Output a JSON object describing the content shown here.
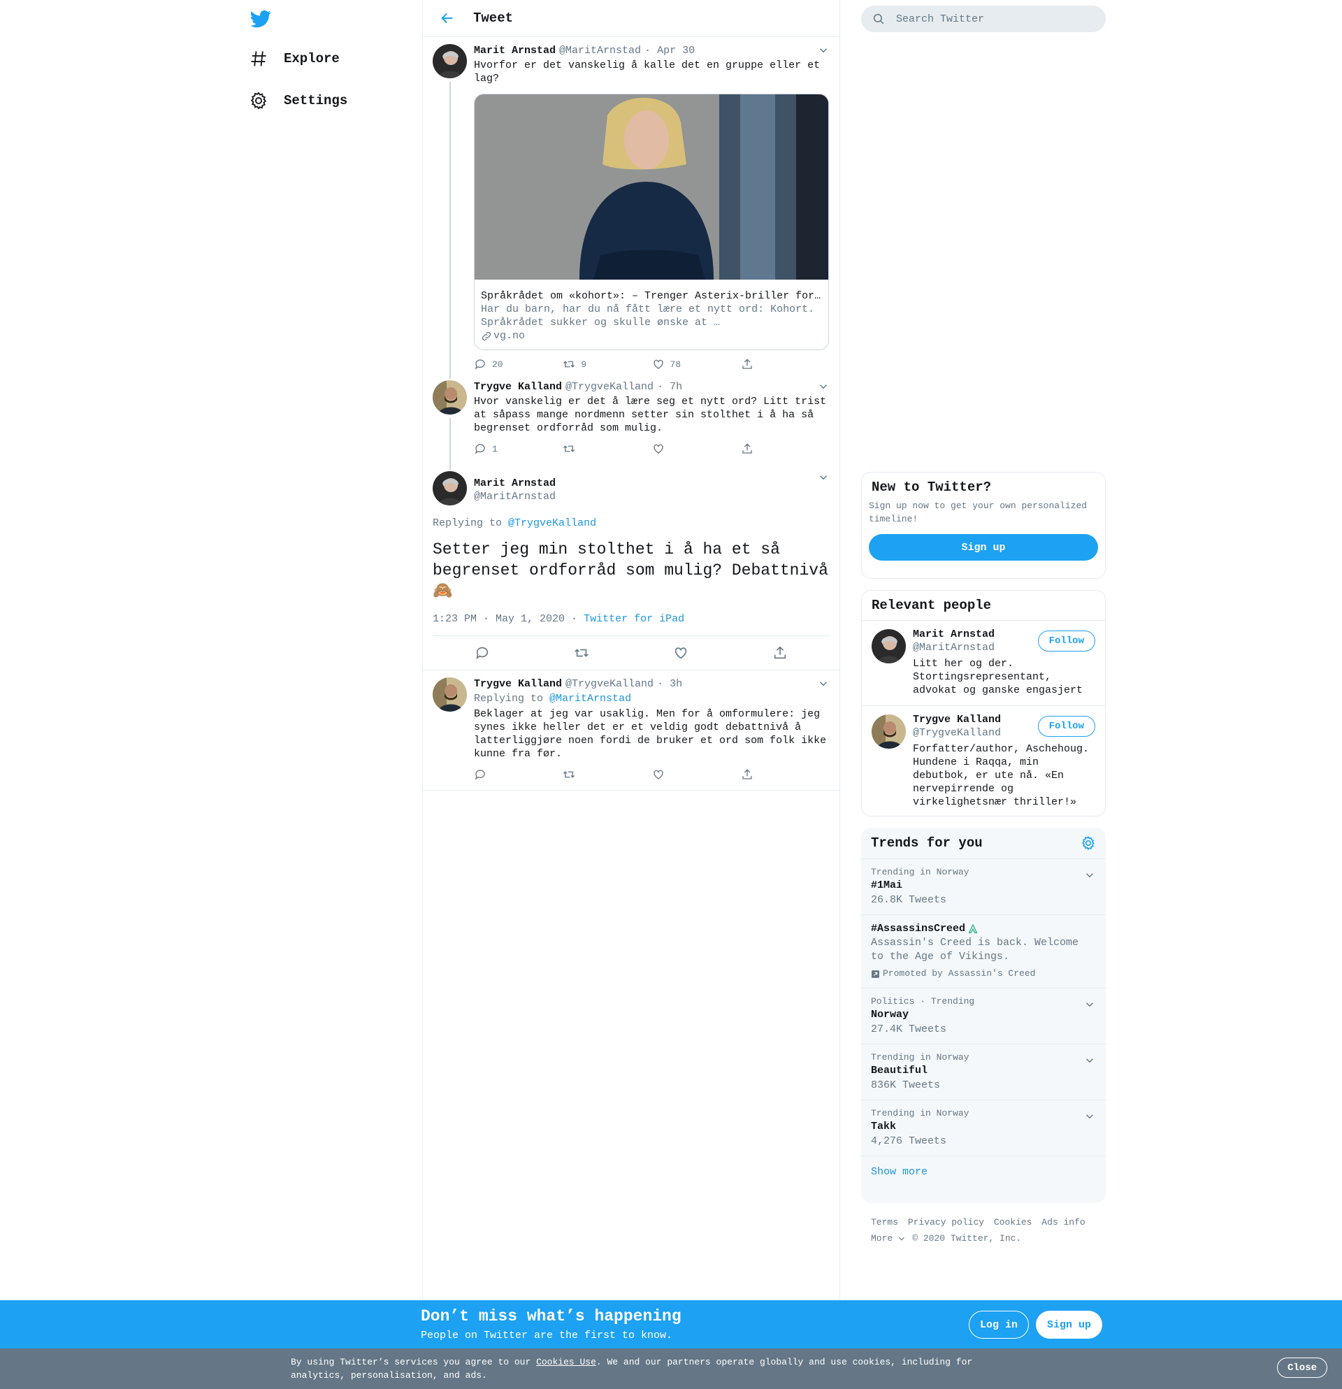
{
  "colors": {
    "accent": "#1da1f2",
    "link": "#1b95e0",
    "muted": "#657786",
    "border": "#e6ecf0"
  },
  "nav": {
    "items": [
      {
        "label": "Explore",
        "icon": "hashtag-icon"
      },
      {
        "label": "Settings",
        "icon": "gear-icon"
      }
    ]
  },
  "header": {
    "title": "Tweet"
  },
  "thread": [
    {
      "name": "Marit Arnstad",
      "handle": "@MaritArnstad",
      "time": "· Apr 30",
      "text": "Hvorfor er det vanskelig å kalle det en gruppe eller et lag?",
      "card": {
        "title": "Språkrådet om «kohort»: – Trenger Asterix-briller for…",
        "description": "Har du barn, har du nå fått lære et nytt ord: Kohort. Språkrådet sukker og skulle ønske at …",
        "domain": "vg.no"
      },
      "counts": {
        "reply": "20",
        "retweet": "9",
        "like": "78"
      }
    },
    {
      "name": "Trygve Kalland",
      "handle": "@TrygveKalland",
      "time": "· 7h",
      "text": "Hvor vanskelig er det å lære seg et nytt ord? Litt trist at såpass mange nordmenn setter sin stolthet i å ha så begrenset ordforråd som mulig.",
      "counts": {
        "reply": "1",
        "retweet": "",
        "like": ""
      }
    }
  ],
  "main_tweet": {
    "name": "Marit Arnstad",
    "handle": "@MaritArnstad",
    "replying_prefix": "Replying to",
    "replying_to": "@TrygveKalland",
    "text": "Setter jeg min stolthet i å ha et så begrenset ordforråd som mulig? Debattnivå",
    "emoji": "🙈",
    "timestamp": "1:23 PM · May 1, 2020 ·",
    "source": "Twitter for iPad"
  },
  "reply": {
    "name": "Trygve Kalland",
    "handle": "@TrygveKalland",
    "time": "· 3h",
    "replying_prefix": "Replying to",
    "replying_to": "@MaritArnstad",
    "text": "Beklager at jeg var usaklig. Men for å omformulere: jeg synes ikke heller det er et veldig godt debattnivå å latterliggjøre noen fordi de bruker et ord som folk ikke kunne fra før."
  },
  "search": {
    "placeholder": "Search Twitter"
  },
  "new_to_twitter": {
    "title": "New to Twitter?",
    "description": "Sign up now to get your own personalized timeline!",
    "button": "Sign up"
  },
  "relevant_people": {
    "title": "Relevant people",
    "people": [
      {
        "name": "Marit Arnstad",
        "handle": "@MaritArnstad",
        "bio": "Litt her og der. Stortingsrepresentant, advokat og ganske engasjert",
        "button": "Follow"
      },
      {
        "name": "Trygve Kalland",
        "handle": "@TrygveKalland",
        "bio": "Forfatter/author, Aschehoug. Hundene i Raqqa, min debutbok, er ute nå. «En nervepirrende og virkelighetsnær thriller!»",
        "button": "Follow"
      }
    ]
  },
  "trends": {
    "title": "Trends for you",
    "items": [
      {
        "meta": "Trending in Norway",
        "name": "#1Mai",
        "count": "26.8K Tweets"
      },
      {
        "name": "#AssassinsCreed",
        "description": "Assassin's Creed is back. Welcome to the Age of Vikings.",
        "promoted": "Promoted by Assassin's Creed"
      },
      {
        "meta": "Politics · Trending",
        "name": "Norway",
        "count": "27.4K Tweets"
      },
      {
        "meta": "Trending in Norway",
        "name": "Beautiful",
        "count": "836K Tweets"
      },
      {
        "meta": "Trending in Norway",
        "name": "Takk",
        "count": "4,276 Tweets"
      }
    ],
    "show_more": "Show more"
  },
  "footer": {
    "links": [
      "Terms",
      "Privacy policy",
      "Cookies",
      "Ads info"
    ],
    "more": "More",
    "copyright": "© 2020 Twitter, Inc."
  },
  "bottom_bar": {
    "title": "Don’t miss what’s happening",
    "subtitle": "People on Twitter are the first to know.",
    "login": "Log in",
    "signup": "Sign up"
  },
  "cookie_bar": {
    "prefix": "By using Twitter’s services you agree to our",
    "link": "Cookies Use",
    "suffix": ". We and our partners operate globally and use cookies, including for analytics, personalisation, and ads.",
    "close": "Close"
  }
}
